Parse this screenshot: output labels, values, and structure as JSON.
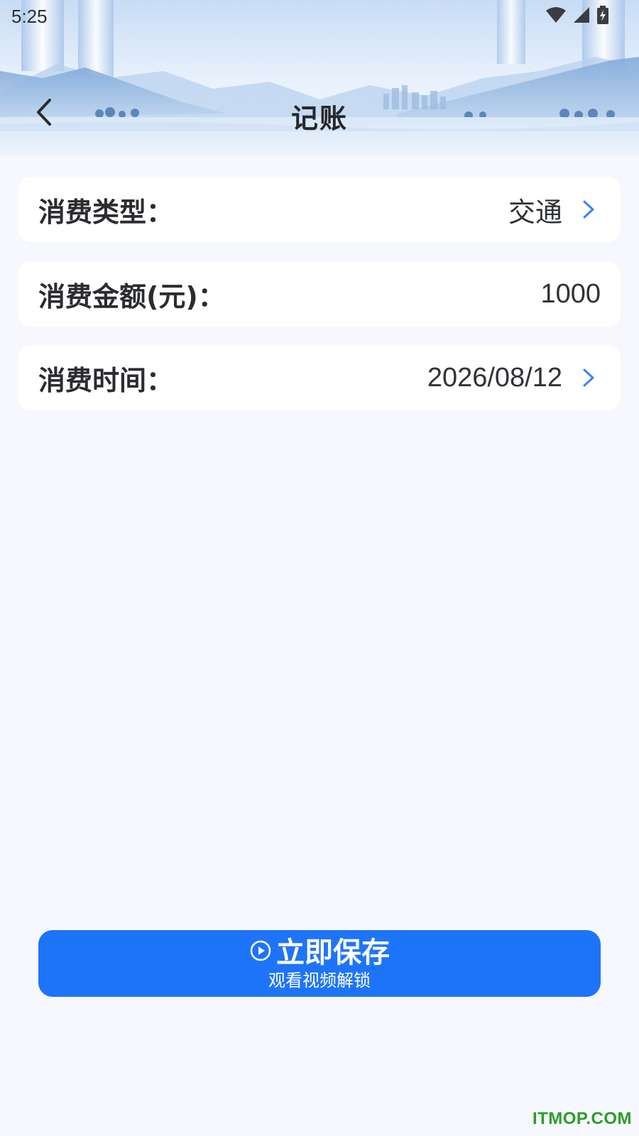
{
  "status_bar": {
    "time": "5:25",
    "icons": [
      "wifi-icon",
      "signal-icon",
      "battery-charging-icon"
    ]
  },
  "header": {
    "title": "记账",
    "back_icon": "chevron-left-icon"
  },
  "form": {
    "type": {
      "label": "消费类型：",
      "value": "交通"
    },
    "amount": {
      "label": "消费金额(元)：",
      "value": "1000"
    },
    "time": {
      "label": "消费时间：",
      "value": "2026/08/12"
    }
  },
  "save_button": {
    "icon": "play-circle-icon",
    "label": "立即保存",
    "sublabel": "观看视频解锁"
  },
  "watermark": "ITMOP.COM",
  "colors": {
    "accent": "#1e74f9",
    "chevron": "#3b82f6",
    "background": "#f6f8fd",
    "watermark": "#2a9d2a"
  }
}
